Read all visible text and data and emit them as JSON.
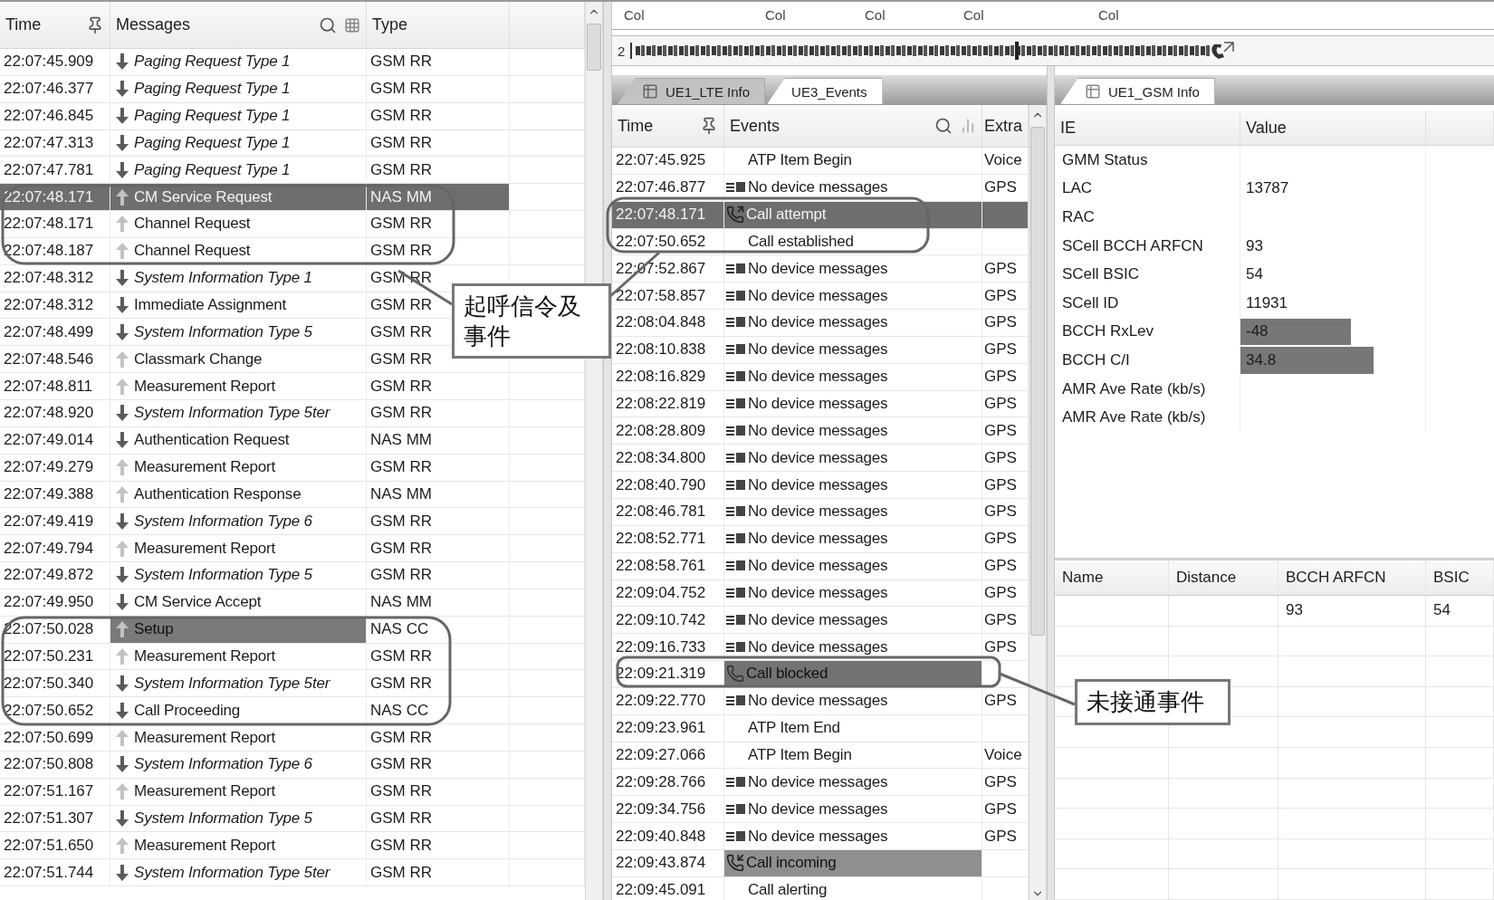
{
  "column_strip": [
    "Col",
    "Col",
    "Col",
    "Col",
    "Col"
  ],
  "timeline_label": "2",
  "messages_panel": {
    "columns": [
      "Time",
      "Messages",
      "Type"
    ],
    "rows": [
      {
        "time": "22:07:45.909",
        "message": "Paging Request Type 1",
        "type": "GSM RR",
        "kind": "downlink",
        "italic": true,
        "selected": false
      },
      {
        "time": "22:07:46.377",
        "message": "Paging Request Type 1",
        "type": "GSM RR",
        "kind": "downlink",
        "italic": true,
        "selected": false
      },
      {
        "time": "22:07:46.845",
        "message": "Paging Request Type 1",
        "type": "GSM RR",
        "kind": "downlink",
        "italic": true,
        "selected": false
      },
      {
        "time": "22:07:47.313",
        "message": "Paging Request Type 1",
        "type": "GSM RR",
        "kind": "downlink",
        "italic": true,
        "selected": false
      },
      {
        "time": "22:07:47.781",
        "message": "Paging Request Type 1",
        "type": "GSM RR",
        "kind": "downlink",
        "italic": true,
        "selected": false
      },
      {
        "time": "22:07:48.171",
        "message": "CM Service Request",
        "type": "NAS MM",
        "kind": "uplink",
        "italic": false,
        "selected": true
      },
      {
        "time": "22:07:48.171",
        "message": "Channel Request",
        "type": "GSM RR",
        "kind": "uplink",
        "italic": false,
        "selected": false
      },
      {
        "time": "22:07:48.187",
        "message": "Channel Request",
        "type": "GSM RR",
        "kind": "uplink",
        "italic": false,
        "selected": false
      },
      {
        "time": "22:07:48.312",
        "message": "System Information Type 1",
        "type": "GSM RR",
        "kind": "downlink",
        "italic": true,
        "selected": false
      },
      {
        "time": "22:07:48.312",
        "message": "Immediate Assignment",
        "type": "GSM RR",
        "kind": "downlink",
        "italic": false,
        "selected": false
      },
      {
        "time": "22:07:48.499",
        "message": "System Information Type 5",
        "type": "GSM RR",
        "kind": "downlink",
        "italic": true,
        "selected": false
      },
      {
        "time": "22:07:48.546",
        "message": "Classmark Change",
        "type": "GSM RR",
        "kind": "uplink",
        "italic": false,
        "selected": false
      },
      {
        "time": "22:07:48.811",
        "message": "Measurement Report",
        "type": "GSM RR",
        "kind": "uplink",
        "italic": false,
        "selected": false
      },
      {
        "time": "22:07:48.920",
        "message": "System Information Type 5ter",
        "type": "GSM RR",
        "kind": "downlink",
        "italic": true,
        "selected": false
      },
      {
        "time": "22:07:49.014",
        "message": "Authentication Request",
        "type": "NAS MM",
        "kind": "downlink",
        "italic": false,
        "selected": false
      },
      {
        "time": "22:07:49.279",
        "message": "Measurement Report",
        "type": "GSM RR",
        "kind": "uplink",
        "italic": false,
        "selected": false
      },
      {
        "time": "22:07:49.388",
        "message": "Authentication Response",
        "type": "NAS MM",
        "kind": "uplink",
        "italic": false,
        "selected": false
      },
      {
        "time": "22:07:49.419",
        "message": "System Information Type 6",
        "type": "GSM RR",
        "kind": "downlink",
        "italic": true,
        "selected": false
      },
      {
        "time": "22:07:49.794",
        "message": "Measurement Report",
        "type": "GSM RR",
        "kind": "uplink",
        "italic": false,
        "selected": false
      },
      {
        "time": "22:07:49.872",
        "message": "System Information Type 5",
        "type": "GSM RR",
        "kind": "downlink",
        "italic": true,
        "selected": false
      },
      {
        "time": "22:07:49.950",
        "message": "CM Service Accept",
        "type": "NAS MM",
        "kind": "downlink",
        "italic": false,
        "selected": false
      },
      {
        "time": "22:07:50.028",
        "message": "Setup",
        "type": "NAS CC",
        "kind": "uplink",
        "italic": false,
        "selected": false,
        "color": "#7a7a7a"
      },
      {
        "time": "22:07:50.231",
        "message": "Measurement Report",
        "type": "GSM RR",
        "kind": "uplink",
        "italic": false,
        "selected": false
      },
      {
        "time": "22:07:50.340",
        "message": "System Information Type 5ter",
        "type": "GSM RR",
        "kind": "downlink",
        "italic": true,
        "selected": false
      },
      {
        "time": "22:07:50.652",
        "message": "Call Proceeding",
        "type": "NAS CC",
        "kind": "downlink",
        "italic": false,
        "selected": false
      },
      {
        "time": "22:07:50.699",
        "message": "Measurement Report",
        "type": "GSM RR",
        "kind": "uplink",
        "italic": false,
        "selected": false
      },
      {
        "time": "22:07:50.808",
        "message": "System Information Type 6",
        "type": "GSM RR",
        "kind": "downlink",
        "italic": true,
        "selected": false
      },
      {
        "time": "22:07:51.167",
        "message": "Measurement Report",
        "type": "GSM RR",
        "kind": "uplink",
        "italic": false,
        "selected": false
      },
      {
        "time": "22:07:51.307",
        "message": "System Information Type 5",
        "type": "GSM RR",
        "kind": "downlink",
        "italic": true,
        "selected": false
      },
      {
        "time": "22:07:51.650",
        "message": "Measurement Report",
        "type": "GSM RR",
        "kind": "uplink",
        "italic": false,
        "selected": false
      },
      {
        "time": "22:07:51.744",
        "message": "System Information Type 5ter",
        "type": "GSM RR",
        "kind": "downlink",
        "italic": true,
        "selected": false
      }
    ]
  },
  "events_panel": {
    "tabs": [
      {
        "label": "UE1_LTE Info",
        "selected": false
      },
      {
        "label": "UE3_Events",
        "selected": true
      }
    ],
    "columns": [
      "Time",
      "Events",
      "Extra"
    ],
    "rows": [
      {
        "time": "22:07:45.925",
        "event": "ATP Item Begin",
        "extra": "Voice",
        "kind": "plain",
        "selected": false
      },
      {
        "time": "22:07:46.877",
        "event": "No device messages",
        "extra": "GPS",
        "kind": "device",
        "selected": false
      },
      {
        "time": "22:07:48.171",
        "event": "Call attempt",
        "kind": "outgoing",
        "selected": true
      },
      {
        "time": "22:07:50.652",
        "event": "Call established",
        "kind": "plain",
        "selected": false
      },
      {
        "time": "22:07:52.867",
        "event": "No device messages",
        "extra": "GPS",
        "kind": "device",
        "selected": false
      },
      {
        "time": "22:07:58.857",
        "event": "No device messages",
        "extra": "GPS",
        "kind": "device",
        "selected": false
      },
      {
        "time": "22:08:04.848",
        "event": "No device messages",
        "extra": "GPS",
        "kind": "device",
        "selected": false
      },
      {
        "time": "22:08:10.838",
        "event": "No device messages",
        "extra": "GPS",
        "kind": "device",
        "selected": false
      },
      {
        "time": "22:08:16.829",
        "event": "No device messages",
        "extra": "GPS",
        "kind": "device",
        "selected": false
      },
      {
        "time": "22:08:22.819",
        "event": "No device messages",
        "extra": "GPS",
        "kind": "device",
        "selected": false
      },
      {
        "time": "22:08:28.809",
        "event": "No device messages",
        "extra": "GPS",
        "kind": "device",
        "selected": false
      },
      {
        "time": "22:08:34.800",
        "event": "No device messages",
        "extra": "GPS",
        "kind": "device",
        "selected": false
      },
      {
        "time": "22:08:40.790",
        "event": "No device messages",
        "extra": "GPS",
        "kind": "device",
        "selected": false
      },
      {
        "time": "22:08:46.781",
        "event": "No device messages",
        "extra": "GPS",
        "kind": "device",
        "selected": false
      },
      {
        "time": "22:08:52.771",
        "event": "No device messages",
        "extra": "GPS",
        "kind": "device",
        "selected": false
      },
      {
        "time": "22:08:58.761",
        "event": "No device messages",
        "extra": "GPS",
        "kind": "device",
        "selected": false
      },
      {
        "time": "22:09:04.752",
        "event": "No device messages",
        "extra": "GPS",
        "kind": "device",
        "selected": false
      },
      {
        "time": "22:09:10.742",
        "event": "No device messages",
        "extra": "GPS",
        "kind": "device",
        "selected": false
      },
      {
        "time": "22:09:16.733",
        "event": "No device messages",
        "extra": "GPS",
        "kind": "device",
        "selected": false
      },
      {
        "time": "22:09:21.319",
        "event": "Call blocked",
        "kind": "blocked",
        "selected": false,
        "color": "#737373"
      },
      {
        "time": "22:09:22.770",
        "event": "No device messages",
        "extra": "GPS",
        "kind": "device",
        "selected": false
      },
      {
        "time": "22:09:23.961",
        "event": "ATP Item End",
        "kind": "plain",
        "selected": false
      },
      {
        "time": "22:09:27.066",
        "event": "ATP Item Begin",
        "extra": "Voice",
        "kind": "plain",
        "selected": false
      },
      {
        "time": "22:09:28.766",
        "event": "No device messages",
        "extra": "GPS",
        "kind": "device",
        "selected": false
      },
      {
        "time": "22:09:34.756",
        "event": "No device messages",
        "extra": "GPS",
        "kind": "device",
        "selected": false
      },
      {
        "time": "22:09:40.848",
        "event": "No device messages",
        "extra": "GPS",
        "kind": "device",
        "selected": false
      },
      {
        "time": "22:09:43.874",
        "event": "Call incoming",
        "kind": "incoming",
        "selected": false,
        "color": "#8f8f8f"
      },
      {
        "time": "22:09:45.091",
        "event": "Call alerting",
        "kind": "plain",
        "selected": false
      }
    ]
  },
  "info_panel": {
    "tabs": [
      {
        "label": "UE1_GSM Info",
        "selected": true
      }
    ],
    "columns": [
      "IE",
      "Value"
    ],
    "rows": [
      {
        "ie": "GMM Status"
      },
      {
        "ie": "LAC",
        "value": "13787"
      },
      {
        "ie": "RAC"
      },
      {
        "ie": "SCell BCCH ARFCN",
        "value": "93"
      },
      {
        "ie": "SCell BSIC",
        "value": "54"
      },
      {
        "ie": "SCell ID",
        "value": "11931"
      },
      {
        "ie": "BCCH RxLev",
        "value": "-48",
        "level": 0.6
      },
      {
        "ie": "BCCH C/I",
        "value": "34.8",
        "level": 0.72
      },
      {
        "ie": "AMR Ave Rate (kb/s)"
      },
      {
        "ie": "AMR Ave Rate (kb/s)"
      }
    ],
    "neighbor_table": {
      "columns": [
        "Name",
        "Distance",
        "BCCH ARFCN",
        "BSIC"
      ],
      "rows": [
        {
          "bcch_arfcn": "93",
          "bsic": "54"
        }
      ]
    }
  },
  "annotations": [
    {
      "text": "起呼信令及事件"
    },
    {
      "text": "未接通事件"
    }
  ]
}
